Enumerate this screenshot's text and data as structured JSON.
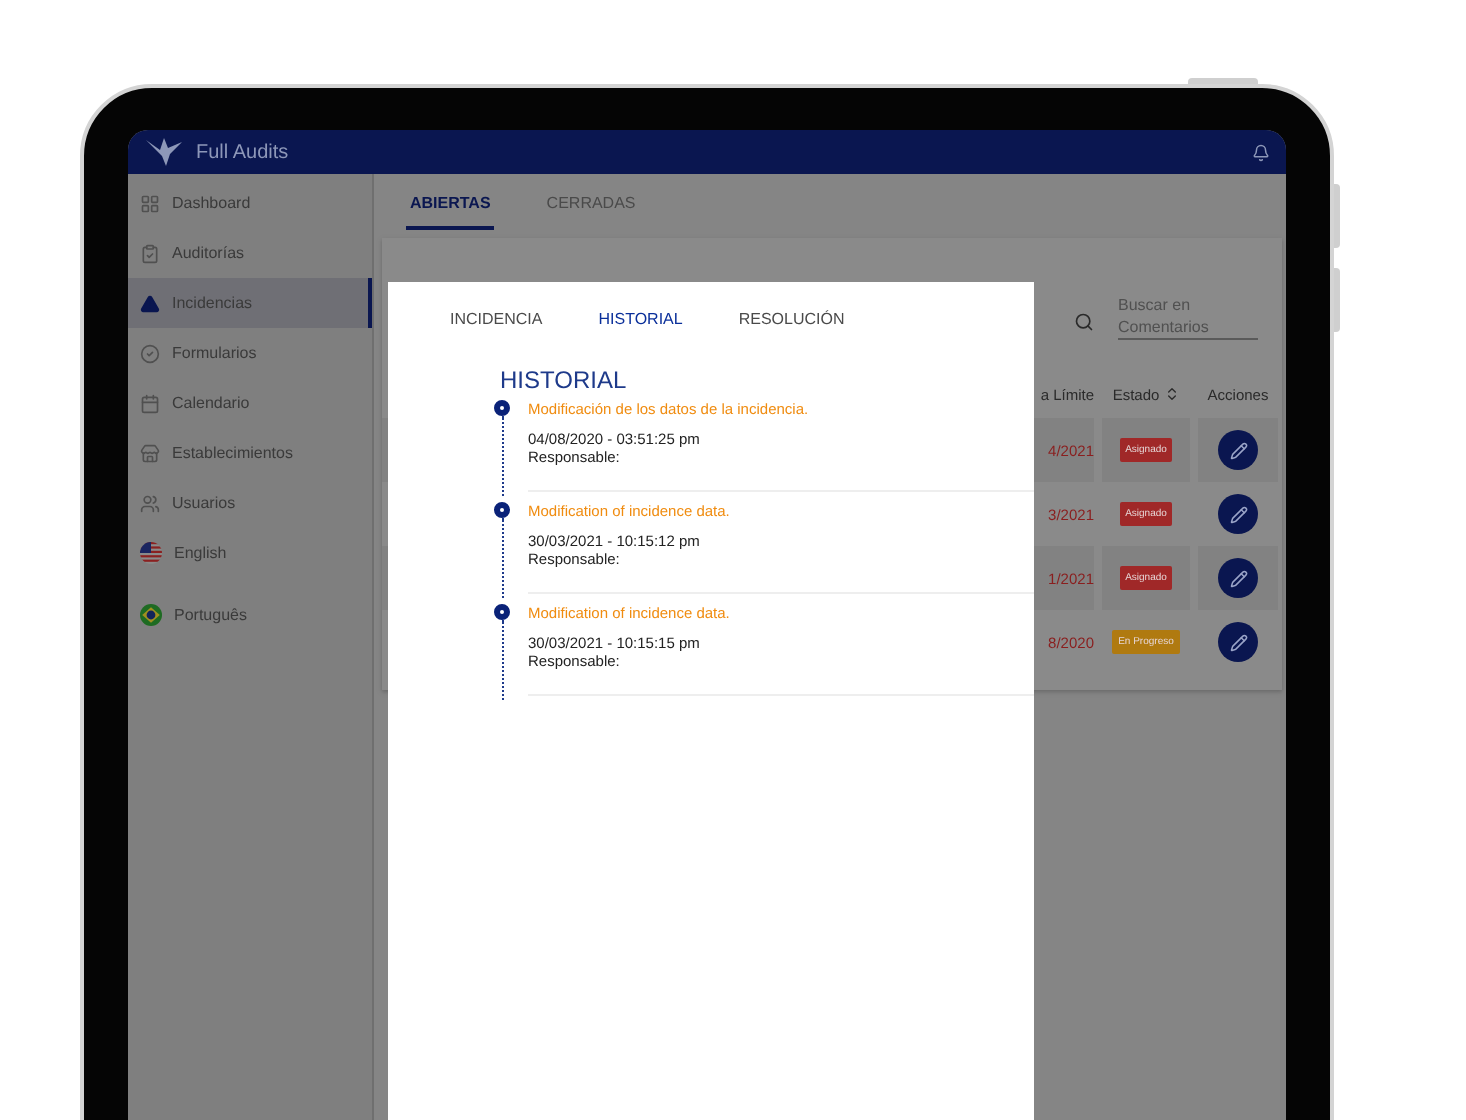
{
  "app": {
    "title": "Full Audits"
  },
  "sidebar": {
    "items": [
      {
        "label": "Dashboard",
        "selected": false
      },
      {
        "label": "Auditorías",
        "selected": false
      },
      {
        "label": "Incidencias",
        "selected": true
      },
      {
        "label": "Formularios",
        "selected": false
      },
      {
        "label": "Calendario",
        "selected": false
      },
      {
        "label": "Establecimientos",
        "selected": false
      },
      {
        "label": "Usuarios",
        "selected": false
      },
      {
        "label": "English",
        "selected": false
      },
      {
        "label": "Português",
        "selected": false
      }
    ]
  },
  "tabs": [
    {
      "label": "ABIERTAS",
      "selected": true
    },
    {
      "label": "CERRADAS",
      "selected": false
    }
  ],
  "table": {
    "search": {
      "placeholder": "Buscar en Comentarios"
    },
    "columns": {
      "date": "a Límite",
      "status": "Estado",
      "actions": "Acciones"
    },
    "rows": [
      {
        "date": "4/2021",
        "status": "Asignado",
        "kind": "assigned"
      },
      {
        "date": "3/2021",
        "status": "Asignado",
        "kind": "assigned"
      },
      {
        "date": "1/2021",
        "status": "Asignado",
        "kind": "assigned"
      },
      {
        "date": "8/2020",
        "status": "En Progreso",
        "kind": "in_progress"
      }
    ]
  },
  "modal": {
    "tabs": [
      {
        "label": "INCIDENCIA",
        "selected": false
      },
      {
        "label": "HISTORIAL",
        "selected": true
      },
      {
        "label": "RESOLUCIÓN",
        "selected": false
      }
    ],
    "title": "HISTORIAL",
    "entries": [
      {
        "title": "Modificación de los datos de la incidencia.",
        "datetime": "04/08/2020 - 03:51:25 pm",
        "responsible": "Responsable:"
      },
      {
        "title": "Modification of incidence data.",
        "datetime": "30/03/2021 - 10:15:12 pm",
        "responsible": "Responsable:"
      },
      {
        "title": "Modification of incidence data.",
        "datetime": "30/03/2021 - 10:15:15 pm",
        "responsible": "Responsable:"
      }
    ]
  }
}
